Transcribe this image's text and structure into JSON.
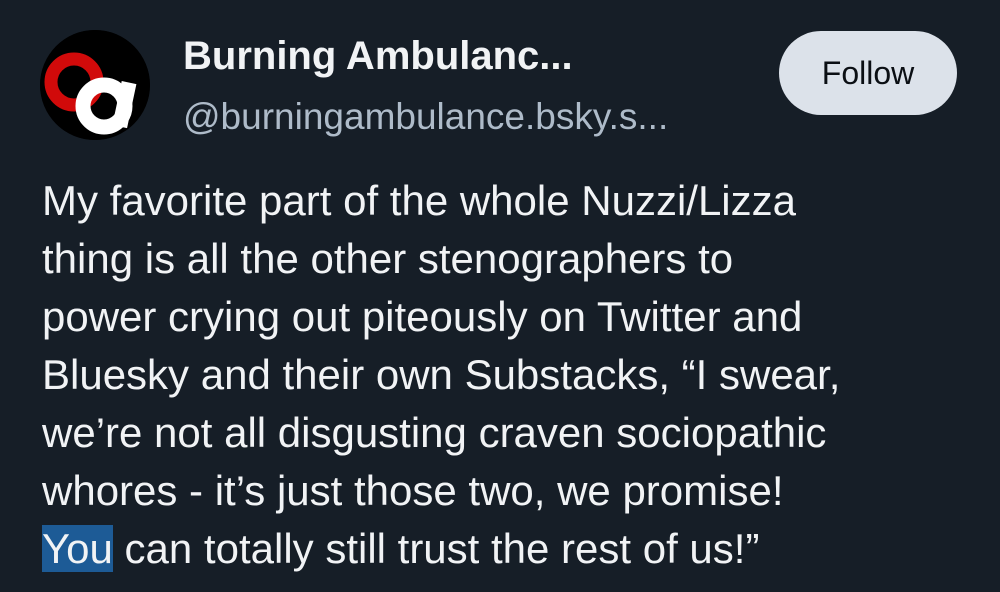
{
  "post": {
    "author": {
      "display_name": "Burning Ambulanc...",
      "handle": "@burningambulance.bsky.s...",
      "avatar_icon": "burning-ambulance-logo"
    },
    "follow_label": "Follow",
    "text_lines": [
      "My favorite part of the whole Nuzzi/Lizza",
      "thing is all the other stenographers to",
      "power crying out piteously on Twitter and",
      "Bluesky and their own Substacks, “I swear,",
      "we’re not all disgusting craven sociopathic",
      "whores - it’s just those two, we promise!"
    ],
    "last_line": {
      "selected": "You",
      "rest": " can totally still trust the rest of us!”"
    }
  },
  "colors": {
    "background": "#161e27",
    "text": "#f1f3f5",
    "handle": "#aebbc9",
    "follow_button_bg": "#dce2ea",
    "selection": "#1d5b96",
    "logo_red": "#d10a0a"
  }
}
